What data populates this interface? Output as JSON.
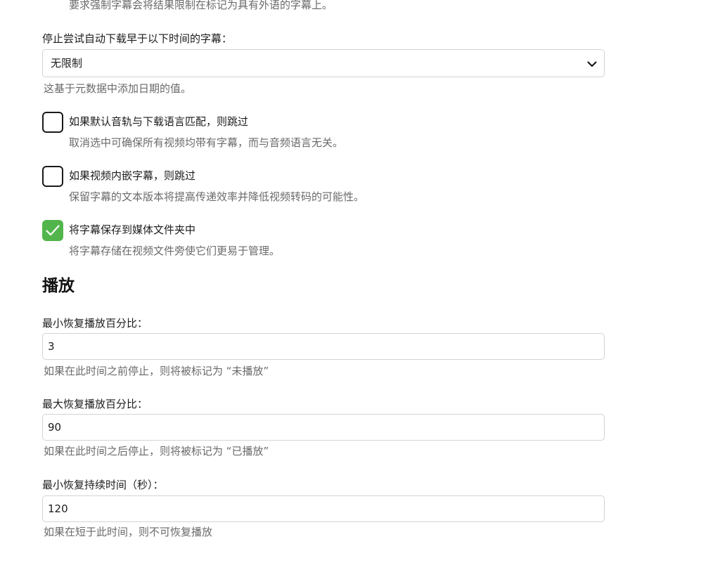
{
  "subtitles": {
    "forced_hint": "要求强制字幕会将结果限制在标记为具有外语的字幕上。",
    "stop_download_label": "停止尝试自动下载早于以下时间的字幕：",
    "stop_download_value": "无限制",
    "stop_download_hint": "这基于元数据中添加日期的值。",
    "skip_if_audio_match": {
      "label": "如果默认音轨与下载语言匹配，则跳过",
      "hint": "取消选中可确保所有视频均带有字幕，而与音频语言无关。",
      "checked": false
    },
    "skip_if_embedded": {
      "label": "如果视频内嵌字幕，则跳过",
      "hint": "保留字幕的文本版本将提高传递效率并降低视频转码的可能性。",
      "checked": false
    },
    "save_with_media": {
      "label": "将字幕保存到媒体文件夹中",
      "hint": "将字幕存储在视频文件旁使它们更易于管理。",
      "checked": true
    }
  },
  "playback": {
    "heading": "播放",
    "min_resume_pct": {
      "label": "最小恢复播放百分比：",
      "value": "3",
      "hint": "如果在此时间之前停止，则将被标记为 “未播放”"
    },
    "max_resume_pct": {
      "label": "最大恢复播放百分比：",
      "value": "90",
      "hint": "如果在此时间之后停止，则将被标记为 “已播放”"
    },
    "min_resume_duration": {
      "label": "最小恢复持续时间（秒）：",
      "value": "120",
      "hint": "如果在短于此时间，则不可恢复播放"
    }
  },
  "colors": {
    "checked": "#52b54b",
    "border": "#d4d4d4",
    "hint": "#6a6a6a"
  },
  "icons": {
    "select_chevron": "chevron-down-icon",
    "check": "checkmark-icon"
  }
}
